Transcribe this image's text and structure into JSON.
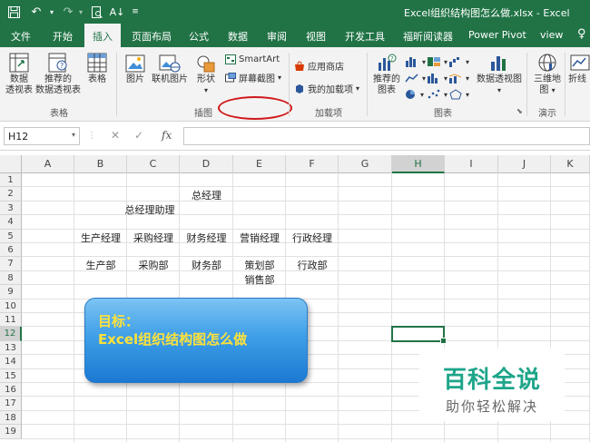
{
  "titlebar": {
    "doc_title": "Excel组织结构图怎么做.xlsx - Excel",
    "colors": {
      "brand": "#217346",
      "accent_red": "#d0191c"
    }
  },
  "tabs": [
    "文件",
    "开始",
    "插入",
    "页面布局",
    "公式",
    "数据",
    "审阅",
    "视图",
    "开发工具",
    "福昕阅读器",
    "Power Pivot",
    "view"
  ],
  "active_tab": "插入",
  "ribbon": {
    "tables": {
      "pivot_line1": "数据",
      "pivot_line2": "透视表",
      "recommended_line1": "推荐的",
      "recommended_line2": "数据透视表",
      "table": "表格",
      "group": "表格"
    },
    "illustrations": {
      "picture": "图片",
      "online_picture": "联机图片",
      "shapes": "形状",
      "smartart": "SmartArt",
      "screenshot": "屏幕截图",
      "group": "插图"
    },
    "addins": {
      "store": "应用商店",
      "my_addins": "我的加载项",
      "group": "加载项"
    },
    "charts": {
      "recommended_line1": "推荐的",
      "recommended_line2": "图表",
      "pivot_chart": "数据透视图",
      "group": "图表"
    },
    "tours": {
      "map3d_line1": "三维地",
      "map3d_line2": "图",
      "group": "演示"
    },
    "sparklines": {
      "line": "折线"
    }
  },
  "formula_bar": {
    "name_box": "H12",
    "fx": "fx",
    "value": ""
  },
  "sheet": {
    "columns": [
      "A",
      "B",
      "C",
      "D",
      "E",
      "F",
      "G",
      "H",
      "I",
      "J",
      "K"
    ],
    "rows": [
      "1",
      "2",
      "3",
      "4",
      "5",
      "6",
      "7",
      "8",
      "9",
      "10",
      "11",
      "12",
      "13",
      "14",
      "15",
      "16",
      "17",
      "18",
      "19"
    ],
    "selected_column": "H",
    "selected_row": "12",
    "cells": {
      "D2": "总经理",
      "C3": "总经理助理",
      "B5": "生产经理",
      "C5": "采购经理",
      "D5": "财务经理",
      "E5": "营销经理",
      "F5": "行政经理",
      "B7": "生产部",
      "C7": "采购部",
      "D7": "财务部",
      "E7": "策划部",
      "F7": "行政部",
      "E8": "销售部"
    }
  },
  "note": {
    "line1": "目标：",
    "line2": "Excel组织结构图怎么做"
  },
  "watermark": {
    "title": "百科全说",
    "subtitle": "助你轻松解决"
  }
}
